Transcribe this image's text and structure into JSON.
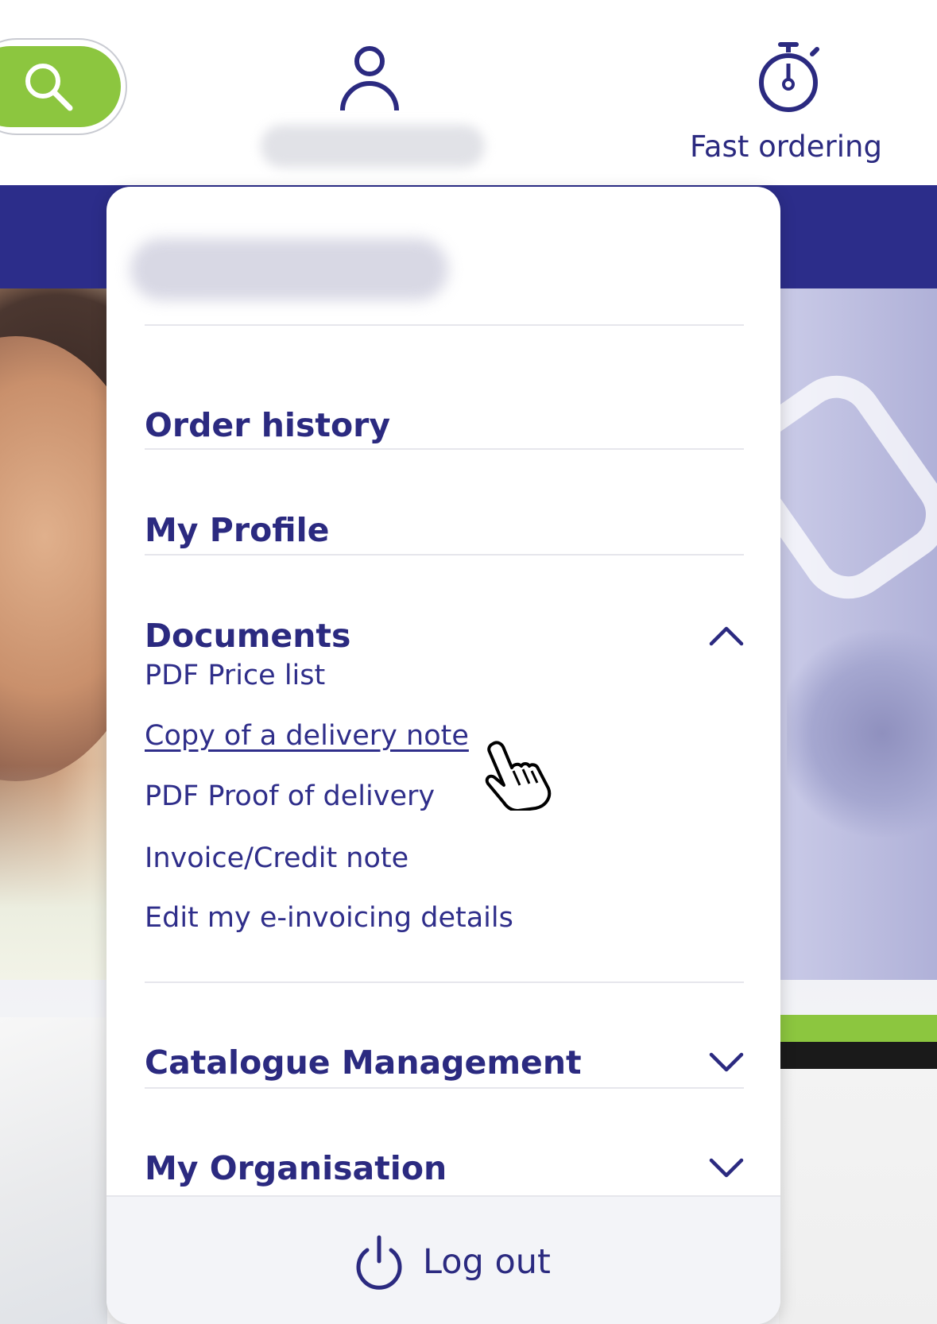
{
  "header": {
    "search_icon": "search-icon",
    "account_icon": "user-icon",
    "fast_ordering": {
      "icon": "stopwatch-icon",
      "label": "Fast ordering"
    }
  },
  "account_menu": {
    "items": [
      {
        "label": "Order history"
      },
      {
        "label": "My Profile"
      },
      {
        "label": "Documents",
        "expanded": true,
        "icon": "chevron-up-icon",
        "links": [
          "PDF Price list",
          "Copy of a delivery note",
          "PDF Proof of delivery",
          "Invoice/Credit note",
          "Edit my e-invoicing details"
        ]
      },
      {
        "label": "Catalogue Management",
        "expanded": false,
        "icon": "chevron-down-icon"
      },
      {
        "label": "My Organisation",
        "expanded": false,
        "icon": "chevron-down-icon"
      }
    ],
    "logout": {
      "label": "Log out",
      "icon": "power-icon"
    }
  },
  "colors": {
    "brand_navy": "#2b2a80",
    "accent_green": "#8cc63f",
    "nav_band": "#2c2d8a"
  }
}
